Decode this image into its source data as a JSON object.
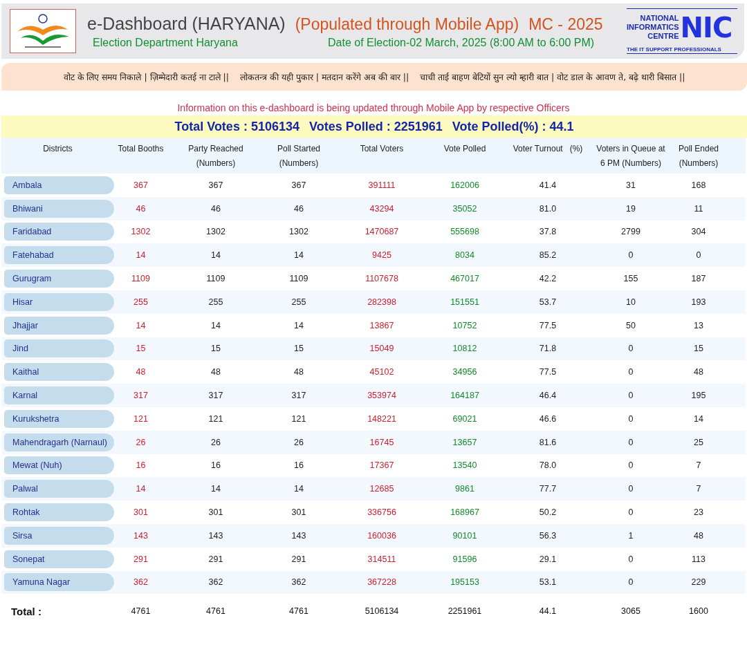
{
  "header": {
    "title": "e-Dashboard (HARYANA)",
    "subtitle": "(Populated through Mobile App)",
    "tag": "MC - 2025",
    "department": "Election Department Haryana",
    "election_date": "Date of Election-02 March, 2025 (8:00 AM to 6:00 PM)",
    "nic_logo": {
      "lines": [
        "NATIONAL",
        "INFORMATICS",
        "CENTRE"
      ],
      "mark": "NIC",
      "tagline": "THE IT SUPPORT PROFESSIONALS"
    }
  },
  "slogans": [
    "वोट के लिए समय निकाले | ज़िम्मेदारी कतई ना टाले ||",
    "लोकतन्त्र की यही पुकार | मतदान करेंगे अब की बार ||",
    "चाची ताई बाहण बेटियों सुन ल्यो म्हारी बात | वोट डाल के आवण ते, बढ़े थारी बिसात ||"
  ],
  "notice": "Information on this e-dashboard is being updated through Mobile App by respective Officers",
  "summary": [
    "Total Votes : 5106134",
    "Votes Polled : 2251961",
    "Vote Polled(%) : 44.1"
  ],
  "table": {
    "columns": [
      "Districts",
      "Total Booths",
      "Party Reached (Numbers)",
      "Poll Started (Numbers)",
      "Total Voters",
      "Vote Polled",
      "Voter Turnout   (%)",
      "Voters in Queue at 6 PM (Numbers)",
      "Poll Ended (Numbers)"
    ],
    "rows": [
      [
        "Ambala",
        "367",
        "367",
        "367",
        "391111",
        "162006",
        "41.4",
        "31",
        "168"
      ],
      [
        "Bhiwani",
        "46",
        "46",
        "46",
        "43294",
        "35052",
        "81.0",
        "19",
        "11"
      ],
      [
        "Faridabad",
        "1302",
        "1302",
        "1302",
        "1470687",
        "555698",
        "37.8",
        "2799",
        "304"
      ],
      [
        "Fatehabad",
        "14",
        "14",
        "14",
        "9425",
        "8034",
        "85.2",
        "0",
        "0"
      ],
      [
        "Gurugram",
        "1109",
        "1109",
        "1109",
        "1107678",
        "467017",
        "42.2",
        "155",
        "187"
      ],
      [
        "Hisar",
        "255",
        "255",
        "255",
        "282398",
        "151551",
        "53.7",
        "10",
        "193"
      ],
      [
        "Jhajjar",
        "14",
        "14",
        "14",
        "13867",
        "10752",
        "77.5",
        "50",
        "13"
      ],
      [
        "Jind",
        "15",
        "15",
        "15",
        "15049",
        "10812",
        "71.8",
        "0",
        "15"
      ],
      [
        "Kaithal",
        "48",
        "48",
        "48",
        "45102",
        "34956",
        "77.5",
        "0",
        "48"
      ],
      [
        "Karnal",
        "317",
        "317",
        "317",
        "353974",
        "164187",
        "46.4",
        "0",
        "195"
      ],
      [
        "Kurukshetra",
        "121",
        "121",
        "121",
        "148221",
        "69021",
        "46.6",
        "0",
        "14"
      ],
      [
        "Mahendragarh (Narnaul)",
        "26",
        "26",
        "26",
        "16745",
        "13657",
        "81.6",
        "0",
        "25"
      ],
      [
        "Mewat (Nuh)",
        "16",
        "16",
        "16",
        "17367",
        "13540",
        "78.0",
        "0",
        "7"
      ],
      [
        "Palwal",
        "14",
        "14",
        "14",
        "12685",
        "9861",
        "77.7",
        "0",
        "7"
      ],
      [
        "Rohtak",
        "301",
        "301",
        "301",
        "336756",
        "168967",
        "50.2",
        "0",
        "23"
      ],
      [
        "Sirsa",
        "143",
        "143",
        "143",
        "160036",
        "90101",
        "56.3",
        "1",
        "48"
      ],
      [
        "Sonepat",
        "291",
        "291",
        "291",
        "314511",
        "91596",
        "29.1",
        "0",
        "113"
      ],
      [
        "Yamuna Nagar",
        "362",
        "362",
        "362",
        "367228",
        "195153",
        "53.1",
        "0",
        "229"
      ]
    ],
    "total": [
      "Total :",
      "4761",
      "4761",
      "4761",
      "5106134",
      "2251961",
      "44.1",
      "3065",
      "1600"
    ]
  }
}
